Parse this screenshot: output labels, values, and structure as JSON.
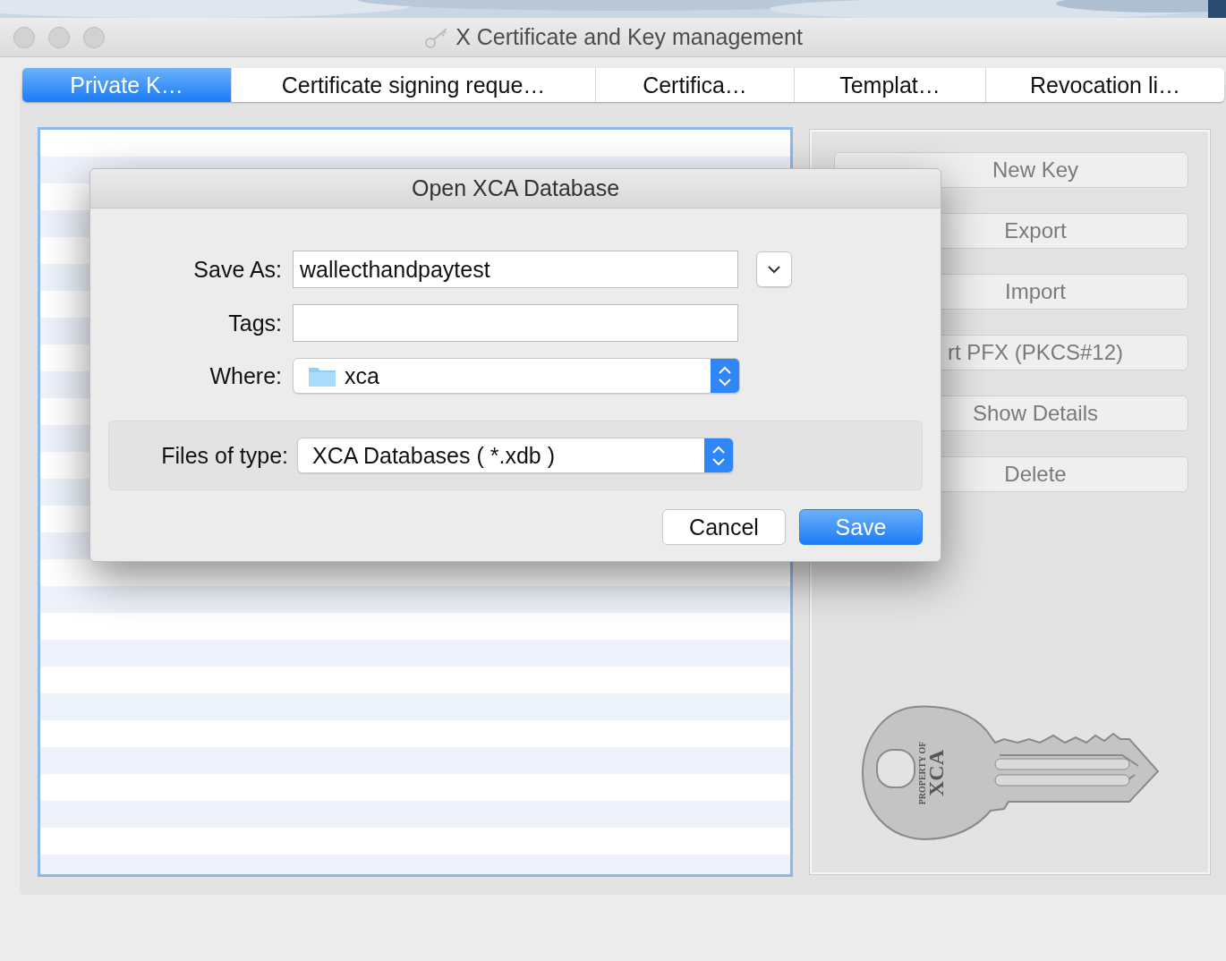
{
  "window": {
    "title": "X Certificate and Key management"
  },
  "tabs": [
    {
      "label": "Private K…",
      "selected": true
    },
    {
      "label": "Certificate signing reque…",
      "selected": false
    },
    {
      "label": "Certifica…",
      "selected": false
    },
    {
      "label": "Templat…",
      "selected": false
    },
    {
      "label": "Revocation li…",
      "selected": false
    }
  ],
  "actions": [
    {
      "label": "New Key"
    },
    {
      "label": "Export"
    },
    {
      "label": "Import"
    },
    {
      "label": "rt PFX (PKCS#12)"
    },
    {
      "label": "Show Details"
    },
    {
      "label": "Delete"
    }
  ],
  "key_emblem": {
    "lines": [
      "PROPERTY OF",
      "XCA"
    ]
  },
  "dialog": {
    "title": "Open XCA Database",
    "save_as": {
      "label": "Save As:",
      "value": "wallecthandpaytest"
    },
    "tags": {
      "label": "Tags:"
    },
    "where": {
      "label": "Where:",
      "value": "xca"
    },
    "file_type": {
      "label": "Files of type:",
      "value": "XCA Databases ( *.xdb )"
    },
    "buttons": [
      {
        "label": "Cancel",
        "kind": "secondary"
      },
      {
        "label": "Save",
        "kind": "default"
      }
    ]
  }
}
